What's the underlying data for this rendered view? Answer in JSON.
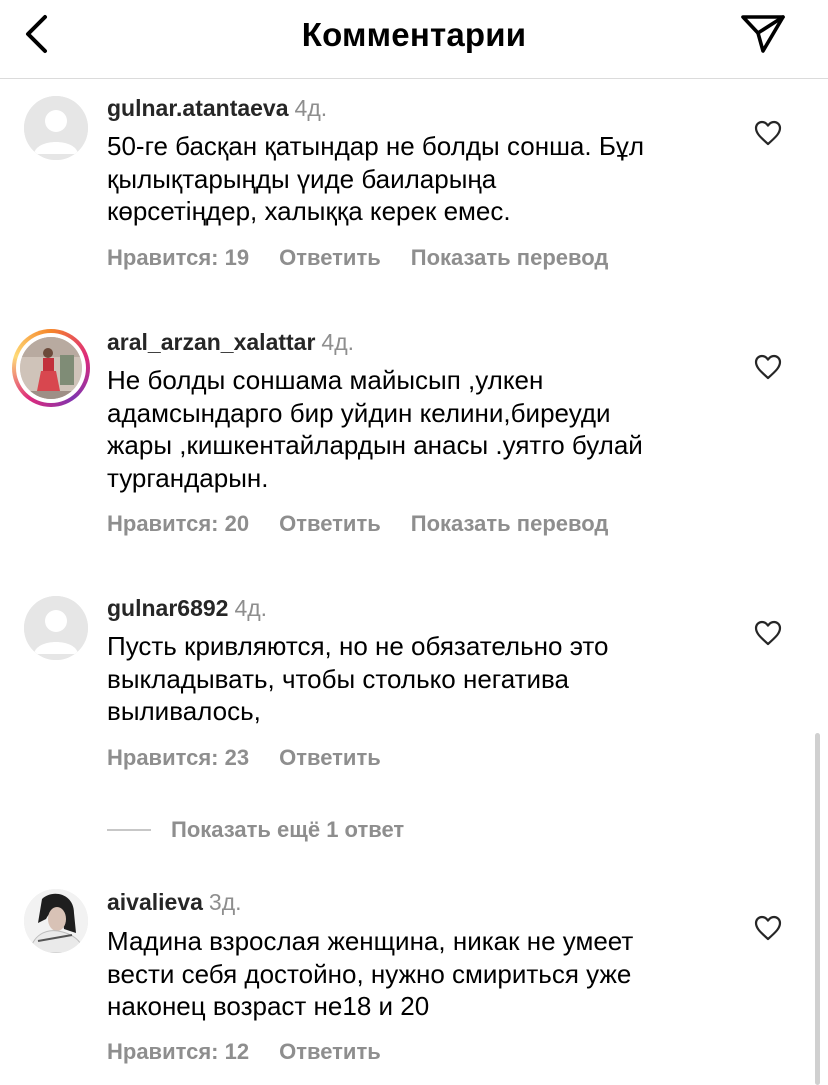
{
  "header": {
    "title": "Комментарии",
    "back_icon": "chevron-left-icon",
    "send_icon": "paper-plane-icon"
  },
  "comments": [
    {
      "username": "gulnar.atantaeva",
      "time": "4д.",
      "text": "50-ге басқан қатындар не болды сонша. Бұл\nқылықтарыңды үиде баиларыңа\nкөрсетіңдер, халыққа керек емес.",
      "likes": "Нравится: 19",
      "reply": "Ответить",
      "translate": "Показать перевод",
      "avatar": "default-avatar"
    },
    {
      "username": "aral_arzan_xalattar",
      "time": "4д.",
      "text": "Не болды соншама майысып ,улкен\nадамсындарго бир уйдин келини,биреуди\nжары ,кишкентайлардын анасы .уятго булай\nтургандарын.",
      "likes": "Нравится: 20",
      "reply": "Ответить",
      "translate": "Показать перевод",
      "avatar": "photo-avatar-story"
    },
    {
      "username": "gulnar6892",
      "time": "4д.",
      "text": "Пусть кривляются,  но не обязательно это\nвыкладывать, чтобы столько негатива\nвыливалось,",
      "likes": "Нравится: 23",
      "reply": "Ответить",
      "avatar": "default-avatar"
    },
    {
      "username": "aivalieva",
      "time": "3д.",
      "text": "Мадина взрослая женщина, никак не умеет\nвести себя достойно, нужно смириться  уже\nнаконец  возраст не18 и 20",
      "likes": "Нравится: 12",
      "reply": "Ответить",
      "avatar": "photo-avatar"
    }
  ],
  "more_replies": "Показать ещё 1 ответ",
  "colors": {
    "secondary_text": "#8e8e8e",
    "divider": "#dbdbdb",
    "story_ring": "#dd2a7b"
  }
}
